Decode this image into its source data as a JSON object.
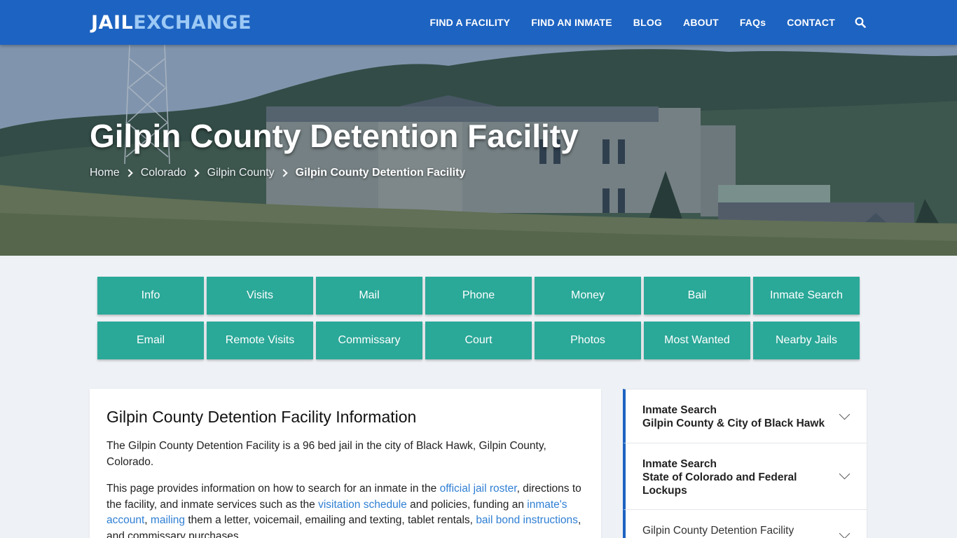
{
  "brand": {
    "logo_part1": "JAIL",
    "logo_part2": "EXCHANGE"
  },
  "nav": {
    "items": [
      "FIND A FACILITY",
      "FIND AN INMATE",
      "BLOG",
      "ABOUT",
      "FAQs",
      "CONTACT"
    ],
    "search_icon": "search-icon"
  },
  "hero": {
    "title": "Gilpin County Detention Facility",
    "breadcrumb": [
      "Home",
      "Colorado",
      "Gilpin County",
      "Gilpin County Detention Facility"
    ]
  },
  "buttons": [
    "Info",
    "Visits",
    "Mail",
    "Phone",
    "Money",
    "Bail",
    "Inmate Search",
    "Email",
    "Remote Visits",
    "Commissary",
    "Court",
    "Photos",
    "Most Wanted",
    "Nearby Jails"
  ],
  "main": {
    "heading": "Gilpin County Detention Facility Information",
    "p1": "The Gilpin County Detention Facility is a 96 bed jail in the city of Black Hawk, Gilpin County, Colorado.",
    "p2": {
      "t1": "This page provides information on how to search for an inmate in the ",
      "link1": "official jail roster",
      "t2": ", directions to the facility, and inmate services such as the ",
      "link2": "visitation schedule",
      "t3": " and policies, funding an ",
      "link3": "inmate's account",
      "t4": ", ",
      "link4": "mailing",
      "t5": " them a letter, voicemail, emailing and texting, tablet rentals, ",
      "link5": "bail bond instructions",
      "t6": ", and commissary purchases."
    }
  },
  "sidebar": {
    "accordion": [
      {
        "line1": "Inmate Search",
        "line2": "Gilpin County & City of Black Hawk"
      },
      {
        "line1": "Inmate Search",
        "line2": "State of Colorado and Federal Lockups"
      },
      {
        "line1": "Gilpin County Detention Facility",
        "line2": ""
      }
    ]
  },
  "colors": {
    "nav_bg": "#1d63c1",
    "tile_bg": "#2aa898",
    "link": "#2f7fd3",
    "logo_accent": "#9cc9f5"
  }
}
